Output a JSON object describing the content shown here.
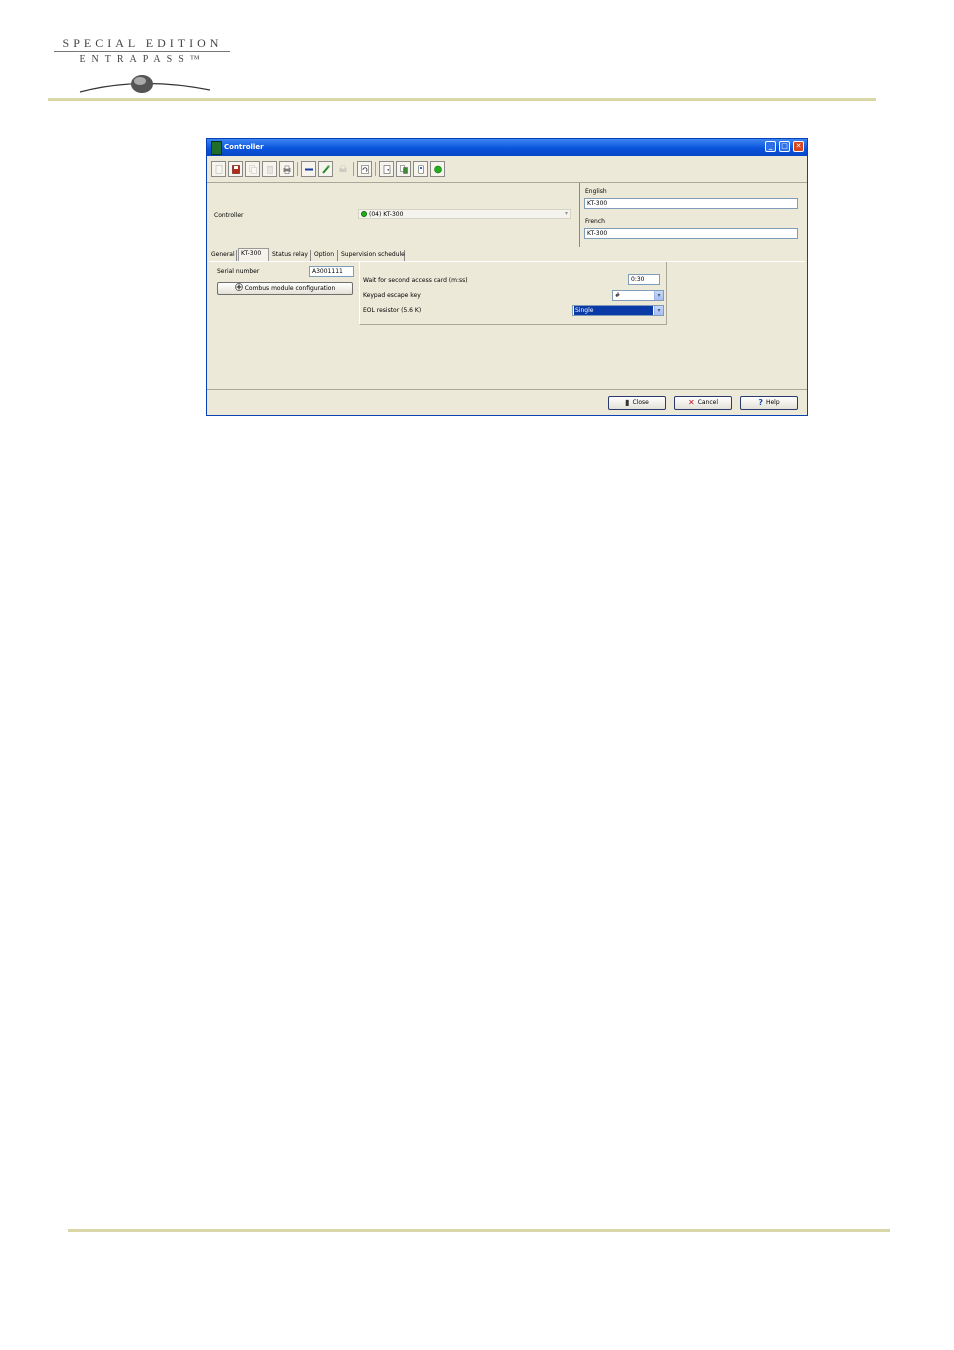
{
  "page": {
    "logo_line1": "SPECIAL EDITION",
    "logo_line2": "ENTRAPASS™"
  },
  "window": {
    "title": "Controller",
    "minimize_label": "_",
    "maximize_label": "□",
    "close_label": "✕"
  },
  "toolbar": {
    "buttons": [
      "new-icon",
      "save-icon",
      "copy-icon",
      "delete-icon",
      "print-icon",
      "minus-icon",
      "link-icon",
      "disabled-print-icon",
      "reload-icon",
      "door-icon",
      "controller-list-icon",
      "card-icon",
      "status-icon"
    ]
  },
  "controller": {
    "label": "Controller",
    "selected": "(04) KT-300"
  },
  "languages": {
    "english_label": "English",
    "english_value": "KT-300",
    "french_label": "French",
    "french_value": "KT-300"
  },
  "tabs": [
    {
      "label": "General"
    },
    {
      "label": "KT-300"
    },
    {
      "label": "Status relay"
    },
    {
      "label": "Option"
    },
    {
      "label": "Supervision schedule"
    }
  ],
  "kt300": {
    "serial_label": "Serial number",
    "serial_value": "A3001111",
    "combus_button": "Combus module configuration",
    "wait_label": "Wait for second access card (m:ss)",
    "wait_value": "0:30",
    "escape_label": "Keypad escape key",
    "escape_value": "#",
    "eol_label": "EOL resistor (5.6 K)",
    "eol_value": "Single"
  },
  "footer_buttons": {
    "close": "Close",
    "cancel": "Cancel",
    "help": "Help"
  },
  "colors": {
    "titlebar": "#0a54dc",
    "window_bg": "#ece9d8",
    "rule": "#d9d7a8",
    "status_green": "#22b020"
  }
}
